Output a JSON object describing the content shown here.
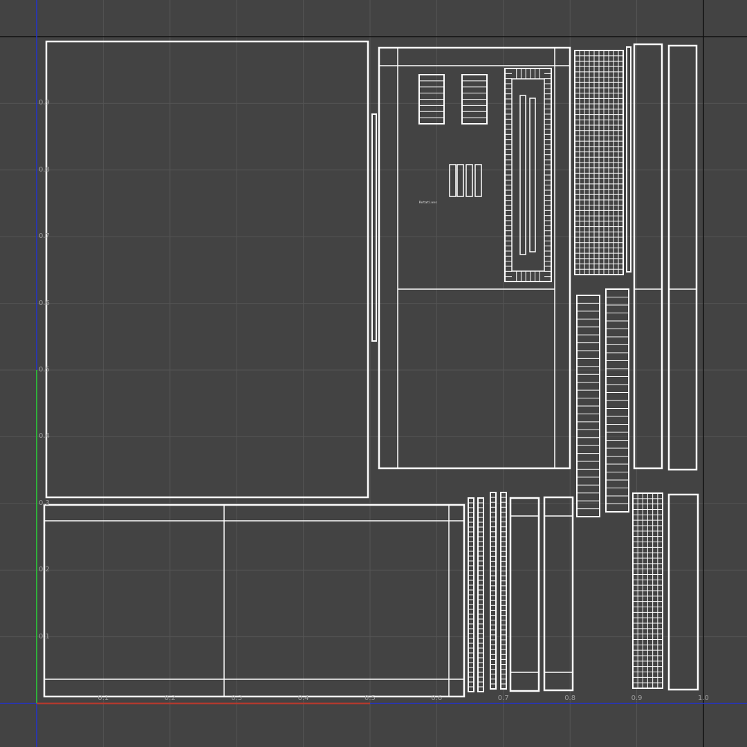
{
  "viewport": {
    "background": "#434343",
    "grid_color": "#555555",
    "wire_color": "#ffffff",
    "axis_colors": {
      "u": "#b03a2e",
      "v": "#2fb03a",
      "frame": "#2233cc",
      "frame_dark": "#111111"
    }
  },
  "axis": {
    "u_ticks": [
      "0.1",
      "0.2",
      "0.3",
      "0.4",
      "0.5",
      "0.6",
      "0.7",
      "0.8",
      "0.9",
      "1.0"
    ],
    "v_ticks": [
      "0.9",
      "0.8",
      "0.7",
      "0.6",
      "0.5",
      "0.4",
      "0.3",
      "0.2",
      "0.1"
    ]
  },
  "label": {
    "text": "Rotations"
  }
}
